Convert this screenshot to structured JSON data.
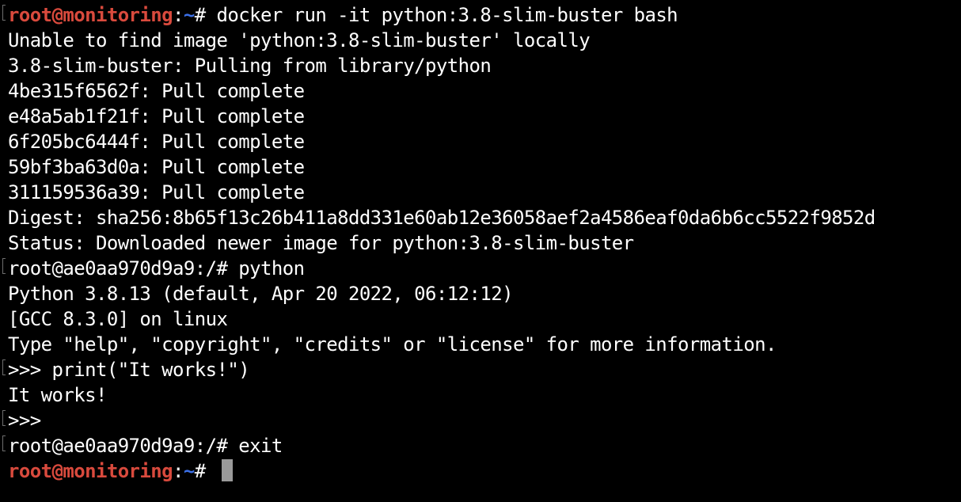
{
  "terminal": {
    "prompt": {
      "user": "root@monitoring",
      "colon": ":",
      "path": "~",
      "symbol": "# "
    },
    "command_docker": "docker run -it python:3.8-slim-buster bash",
    "output": [
      "Unable to find image 'python:3.8-slim-buster' locally",
      "3.8-slim-buster: Pulling from library/python",
      "4be315f6562f: Pull complete",
      "e48a5ab1f21f: Pull complete",
      "6f205bc6444f: Pull complete",
      "59bf3ba63d0a: Pull complete",
      "311159536a39: Pull complete",
      "Digest: sha256:8b65f13c26b411a8dd331e60ab12e36058aef2a4586eaf0da6b6cc5522f9852d",
      "Status: Downloaded newer image for python:3.8-slim-buster"
    ],
    "container_prompt_python": "root@ae0aa970d9a9:/# python",
    "python_banner": [
      "Python 3.8.13 (default, Apr 20 2022, 06:12:12)",
      "[GCC 8.3.0] on linux",
      "Type \"help\", \"copyright\", \"credits\" or \"license\" for more information."
    ],
    "repl_print": ">>> print(\"It works!\")",
    "repl_output": "It works!",
    "repl_empty": ">>>",
    "container_prompt_exit": "root@ae0aa970d9a9:/# exit"
  },
  "colors": {
    "background": "#000000",
    "text": "#ffffff",
    "prompt_user": "#d94a3d",
    "prompt_path": "#3b6fe6",
    "cursor": "#9a9a9a"
  }
}
